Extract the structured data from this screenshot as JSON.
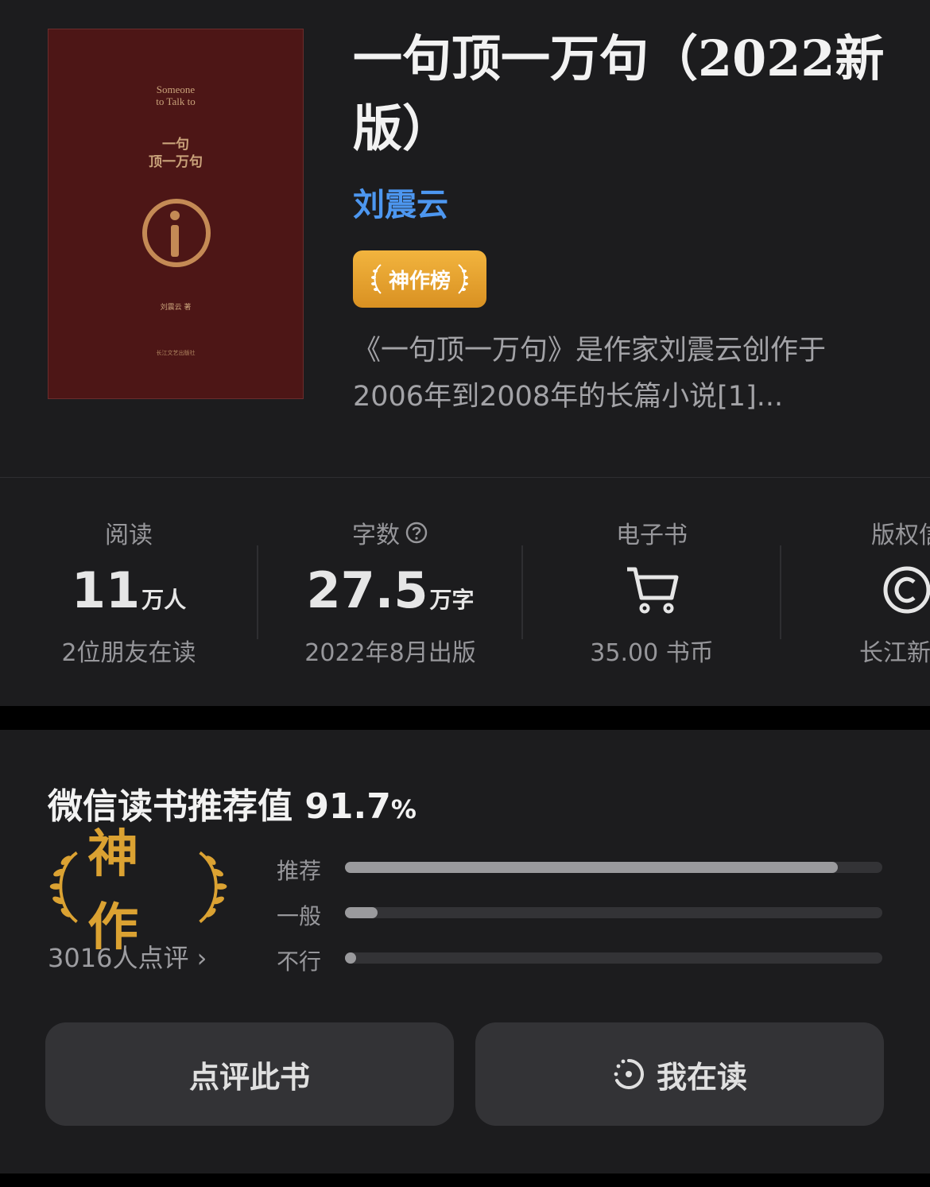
{
  "cover": {
    "en_title_line1": "Someone",
    "en_title_line2": "to Talk to",
    "cn_title_line1": "一句",
    "cn_title_line2": "顶一万句",
    "author": "刘震云 著",
    "publisher": "长江文艺出版社"
  },
  "book": {
    "title": "一句顶一万句（2022新版）",
    "author": "刘震云",
    "badge": "神作榜",
    "description": "《一句顶一万句》是作家刘震云创作于2006年到2008年的长篇小说[1]..."
  },
  "stats": [
    {
      "label": "阅读",
      "value": "11",
      "unit": "万人",
      "sub": "2位朋友在读"
    },
    {
      "label": "字数",
      "value": "27.5",
      "unit": "万字",
      "sub": "2022年8月出版",
      "icon": "question-circle-icon"
    },
    {
      "label": "电子书",
      "icon": "cart-icon",
      "sub": "35.00 书币"
    },
    {
      "label": "版权信",
      "icon": "copyright-icon",
      "sub": "长江新世"
    }
  ],
  "recommend": {
    "title": "微信读书推荐值 91.7",
    "pct_sign": "%",
    "rating_label": "神作",
    "reviews": "3016人点评",
    "bars": [
      {
        "label": "推荐",
        "value": 0.917
      },
      {
        "label": "一般",
        "value": 0.06
      },
      {
        "label": "不行",
        "value": 0.02
      }
    ]
  },
  "actions": {
    "review": "点评此书",
    "reading": "我在读"
  },
  "colors": {
    "author_link": "#4d97f0",
    "badge_gold": "#e5a32e",
    "rating_gold": "#dba232",
    "cover_bg": "#4d1616"
  }
}
